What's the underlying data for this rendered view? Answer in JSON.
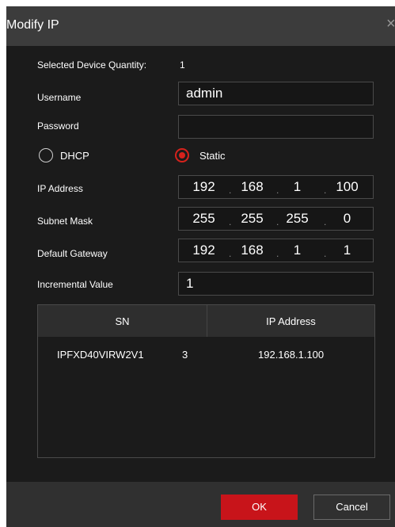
{
  "dialog": {
    "title": "Modify IP",
    "close_glyph": "×"
  },
  "fields": {
    "quantity_label": "Selected Device Quantity:",
    "quantity_value": "1",
    "username_label": "Username",
    "username_value": "admin",
    "password_label": "Password",
    "password_value": "",
    "dhcp_label": "DHCP",
    "static_label": "Static",
    "mode_selected": "Static",
    "ip_label": "IP Address",
    "ip": [
      "192",
      "168",
      "1",
      "100"
    ],
    "subnet_label": "Subnet Mask",
    "subnet": [
      "255",
      "255",
      "255",
      "0"
    ],
    "gateway_label": "Default Gateway",
    "gateway": [
      "192",
      "168",
      "1",
      "1"
    ],
    "increment_label": "Incremental Value",
    "increment_value": "1"
  },
  "table": {
    "headers": [
      "SN",
      "IP Address"
    ],
    "rows": [
      {
        "sn": "IPFXD40VIRW2V1",
        "extra": "3",
        "ip": "192.168.1.100"
      }
    ]
  },
  "footer": {
    "ok_label": "OK",
    "cancel_label": "Cancel"
  },
  "colors": {
    "accent": "#d6221c",
    "ok_button": "#c8141a",
    "dialog_bg": "#1b1b1b"
  }
}
